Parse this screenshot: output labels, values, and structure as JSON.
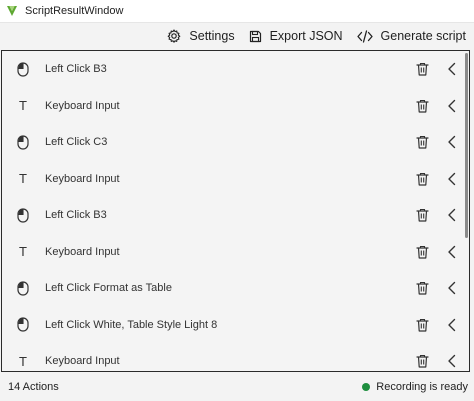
{
  "window": {
    "title": "ScriptResultWindow"
  },
  "toolbar": {
    "settings_label": "Settings",
    "export_label": "Export JSON",
    "generate_label": "Generate script"
  },
  "actions": [
    {
      "type": "mouse",
      "label": "Left Click B3"
    },
    {
      "type": "keyboard",
      "label": "Keyboard Input"
    },
    {
      "type": "mouse",
      "label": "Left Click C3"
    },
    {
      "type": "keyboard",
      "label": "Keyboard Input"
    },
    {
      "type": "mouse",
      "label": "Left Click B3"
    },
    {
      "type": "keyboard",
      "label": "Keyboard Input"
    },
    {
      "type": "mouse",
      "label": "Left Click Format as Table"
    },
    {
      "type": "mouse",
      "label": "Left Click White, Table Style Light 8"
    },
    {
      "type": "keyboard",
      "label": "Keyboard Input"
    }
  ],
  "keyboard_glyph": "T",
  "status": {
    "count_text": "14 Actions",
    "state_text": "Recording is ready",
    "state_color": "#1e8e3e"
  }
}
